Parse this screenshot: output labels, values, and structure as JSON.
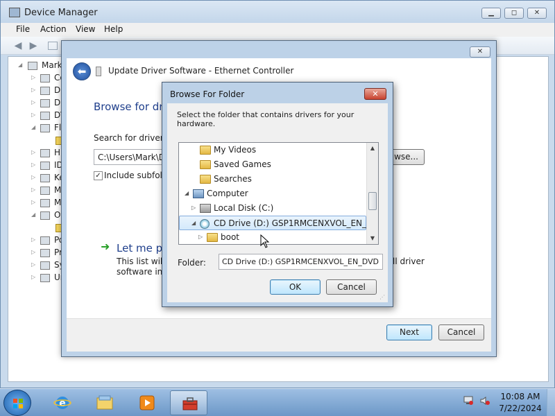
{
  "device_manager": {
    "title": "Device Manager",
    "menu": [
      "File",
      "Action",
      "View",
      "Help"
    ],
    "tree": [
      {
        "label": "Mark-"
      },
      {
        "label": "Co"
      },
      {
        "label": "Di"
      },
      {
        "label": "Di"
      },
      {
        "label": "DV"
      },
      {
        "label": "Flo"
      },
      {
        "label": ""
      },
      {
        "label": "Hu"
      },
      {
        "label": "ID"
      },
      {
        "label": "Ke"
      },
      {
        "label": "Mi"
      },
      {
        "label": "Mo"
      },
      {
        "label": "Ot"
      },
      {
        "label": ""
      },
      {
        "label": "Po"
      },
      {
        "label": "Pro"
      },
      {
        "label": "Sy"
      },
      {
        "label": "Ur"
      }
    ]
  },
  "update_driver": {
    "title": "Update Driver Software - Ethernet Controller",
    "heading": "Browse for dri",
    "search_label": "Search for driver so",
    "path_value": "C:\\Users\\Mark\\Do",
    "browse_label": "wse...",
    "include_subfolders": "Include subfold",
    "pick_title": "Let me pic",
    "pick_desc_1": "This list will s",
    "pick_desc_2": "software in th",
    "pick_desc_right": "ll driver",
    "next_label": "Next",
    "cancel_label": "Cancel",
    "close_icon": "x-icon"
  },
  "browse_folder": {
    "title": "Browse For Folder",
    "instruction": "Select the folder that contains drivers for your hardware.",
    "items": [
      {
        "label": "My Videos",
        "icon": "folder-icon"
      },
      {
        "label": "Saved Games",
        "icon": "folder-icon"
      },
      {
        "label": "Searches",
        "icon": "folder-icon"
      },
      {
        "label": "Computer",
        "icon": "computer-icon"
      },
      {
        "label": "Local Disk (C:)",
        "icon": "disk-icon"
      },
      {
        "label": "CD Drive (D:) GSP1RMCENXVOL_EN_DVD",
        "icon": "dvd-icon",
        "selected": true
      },
      {
        "label": "boot",
        "icon": "folder-icon"
      }
    ],
    "folder_label": "Folder:",
    "folder_value": "CD Drive (D:) GSP1RMCENXVOL_EN_DVD",
    "ok_label": "OK",
    "cancel_label": "Cancel"
  },
  "taskbar": {
    "time": "10:08 AM",
    "date": "7/22/2024"
  }
}
